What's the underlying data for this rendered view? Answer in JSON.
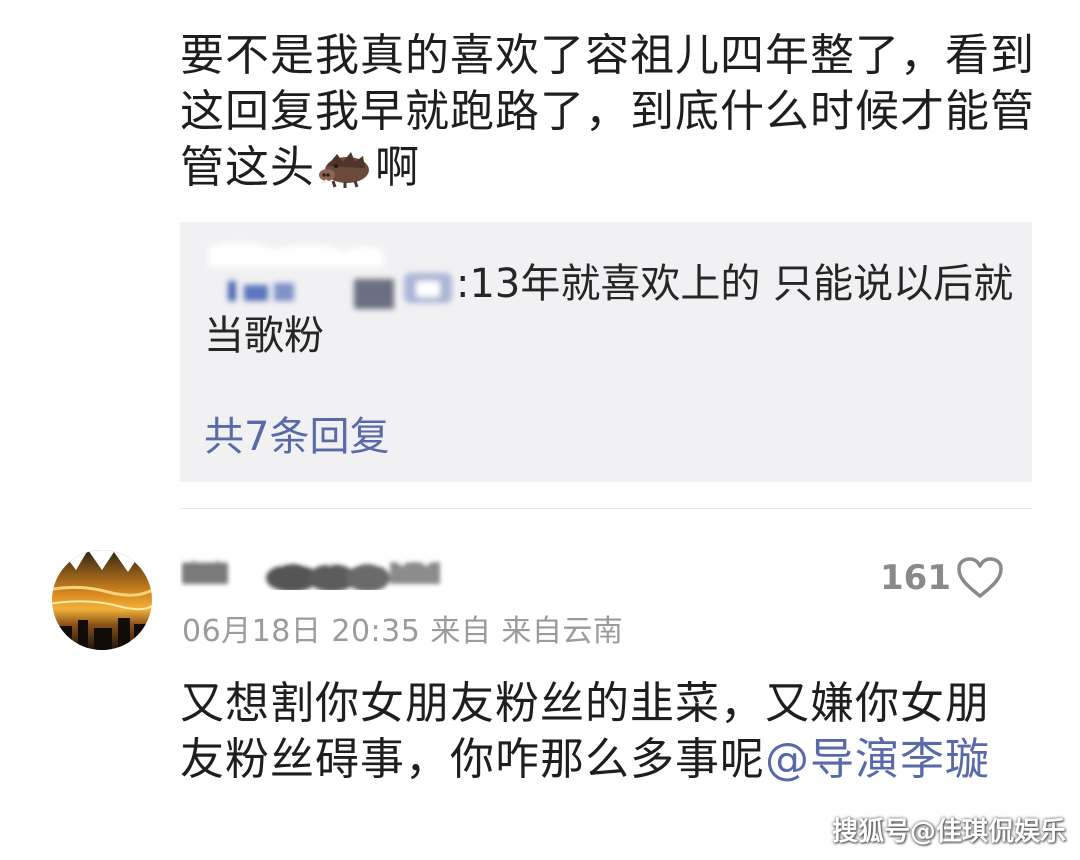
{
  "top_comment": {
    "text_before_icon": "要不是我真的喜欢了容祖儿四年整了，看到这回复我早就跑路了，到底什么时候才能管管这头",
    "icon": "boar-emoji-icon",
    "text_after_icon": "啊"
  },
  "reply_box": {
    "reply_text": ":13年就喜欢上的 只能说以后就当歌粉",
    "reply_count_label": "共7条回复"
  },
  "comment": {
    "likes": "161",
    "timestamp": "06月18日 20:35",
    "source": "来自 来自云南",
    "body": "又想割你女朋友粉丝的韭菜，又嫌你女朋友粉丝碍事，你咋那么多事呢",
    "mention": "@导演李璇"
  },
  "watermark": "搜狐号@佳琪侃娱乐",
  "colors": {
    "link": "#5a6aa8",
    "meta": "#9b9b9b",
    "reply_bg": "#f1f1f3"
  }
}
